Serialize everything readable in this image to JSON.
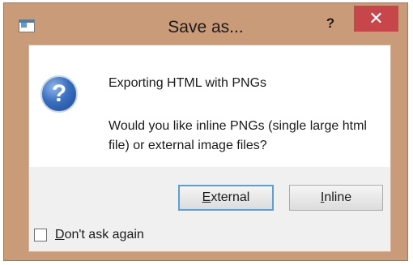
{
  "window": {
    "title": "Save as...",
    "help_glyph": "?",
    "close_glyph": "✕",
    "app_icon": "window-icon"
  },
  "dialog": {
    "icon": "question-icon",
    "icon_glyph": "?",
    "heading": "Exporting HTML with PNGs",
    "message": "Would you like inline PNGs (single large html file) or external image files?",
    "buttons": {
      "external": "External",
      "inline": "Inline"
    },
    "checkbox": {
      "label": "Don't ask again",
      "checked": false
    }
  },
  "colors": {
    "frame": "#c99b78",
    "close": "#c7464a",
    "accent": "#5aa0d6"
  }
}
